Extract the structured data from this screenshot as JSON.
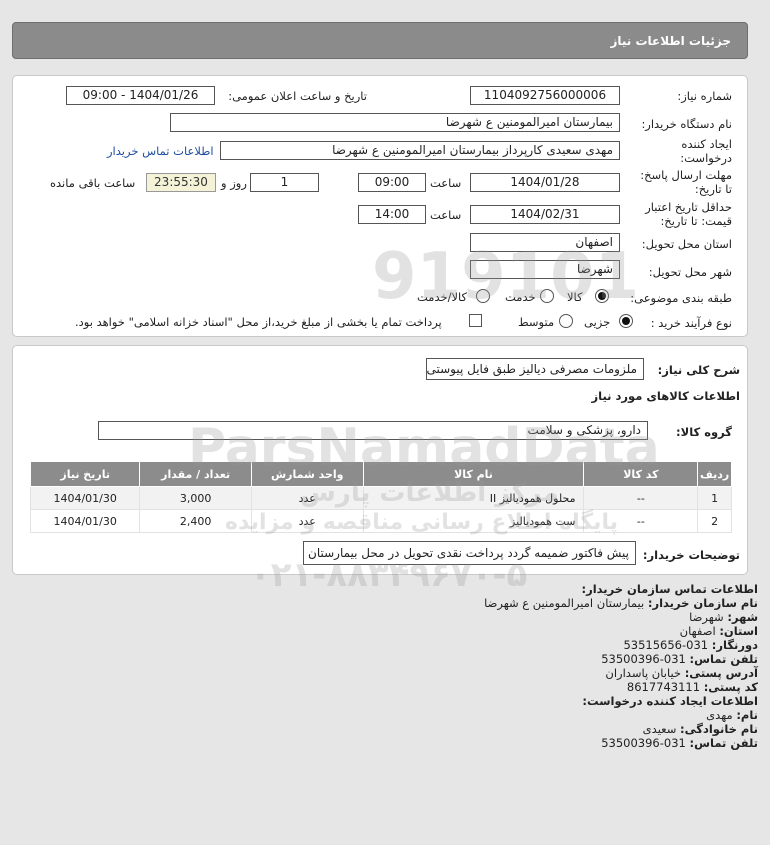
{
  "header": {
    "title": "جزئیات اطلاعات نیاز"
  },
  "form": {
    "need_number_label": "شماره نیاز:",
    "need_number": "1104092756000006",
    "announce_label": "تاریخ و ساعت اعلان عمومی:",
    "announce_value": "1404/01/26 - 09:00",
    "buyer_org_label": "نام دستگاه خریدار:",
    "buyer_org": "بیمارستان امیرالمومنین ع  شهرضا",
    "creator_label_1": "ایجاد کننده",
    "creator_label_2": "درخواست:",
    "creator": "مهدی سعیدی کارپرداز بیمارستان امیرالمومنین ع  شهرضا",
    "contact_link": "اطلاعات تماس خریدار",
    "deadline_label_1": "مهلت ارسال پاسخ:",
    "deadline_label_2": "تا تاریخ:",
    "deadline_date": "1404/01/28",
    "time_label": "ساعت",
    "deadline_time": "09:00",
    "days_value": "1",
    "days_label": "روز و",
    "remaining_time": "23:55:30",
    "remaining_label": "ساعت باقی مانده",
    "validity_label_1": "حداقل تاریخ اعتبار",
    "validity_label_2": "قیمت: تا تاریخ:",
    "validity_date": "1404/02/31",
    "validity_time": "14:00",
    "province_label": "استان محل تحویل:",
    "province": "اصفهان",
    "city_label": "شهر محل تحویل:",
    "city": "شهرضا",
    "category_label": "طبقه بندی موضوعی:",
    "category_options": [
      "کالا",
      "خدمت",
      "کالا/خدمت"
    ],
    "process_label": "نوع فرآیند خرید :",
    "process_options": [
      "جزیی",
      "متوسط"
    ],
    "payment_note": "پرداخت تمام یا بخشی از مبلغ خرید،از محل \"اسناد خزانه اسلامی\" خواهد بود."
  },
  "details": {
    "summary_label": "شرح کلی نیاز:",
    "summary": "ملزومات مصرفی دیالیز طبق فایل پیوستی",
    "goods_title": "اطلاعات کالاهای مورد نیاز",
    "group_label": "گروه کالا:",
    "group": "دارو، پزشکی و سلامت",
    "table": {
      "headers": [
        "ردیف",
        "کد کالا",
        "نام کالا",
        "واحد شمارش",
        "تعداد / مقدار",
        "تاریخ نیاز"
      ],
      "rows": [
        [
          "1",
          "--",
          "محلول همودیالیز II",
          "عدد",
          "3,000",
          "1404/01/30"
        ],
        [
          "2",
          "--",
          "ست همودیالیز",
          "عدد",
          "2,400",
          "1404/01/30"
        ]
      ]
    },
    "buyer_notes_label": "توضیحات خریدار:",
    "buyer_notes": "پیش فاکتور ضمیمه گردد پرداخت نقدی تحویل در محل بیمارستان"
  },
  "contact": {
    "title": "اطلاعات تماس سازمان خریدار:",
    "org_label": "نام سازمان خریدار:",
    "org": "بیمارستان امیرالمومنین ع شهرضا",
    "city_label": "شهر:",
    "city": "شهرضا",
    "province_label": "استان:",
    "province": "اصفهان",
    "fax_label": "دورنگار:",
    "fax": "031-53515656",
    "phone_label": "تلفن تماس:",
    "phone": "031-53500396",
    "address_label": "آدرس پستی:",
    "address": "خیابان پاسداران",
    "postal_label": "کد پستی:",
    "postal": "8617743111",
    "creator_title": "اطلاعات ایجاد کننده درخواست:",
    "name_label": "نام:",
    "name": "مهدی",
    "family_label": "نام خانوادگی:",
    "family": "سعیدی",
    "creator_phone_label": "تلفن تماس:",
    "creator_phone": "031-53500396"
  },
  "watermark": {
    "line1": "ParsNamadData",
    "line2": "مرکز اطلاعات پارس",
    "line3": "پایگاه اطلاع رسانی مناقصه و مزایده",
    "line4": "۰۲۱-۸۸۳۴۹۶۷۰-۵",
    "big_number": "919101"
  }
}
